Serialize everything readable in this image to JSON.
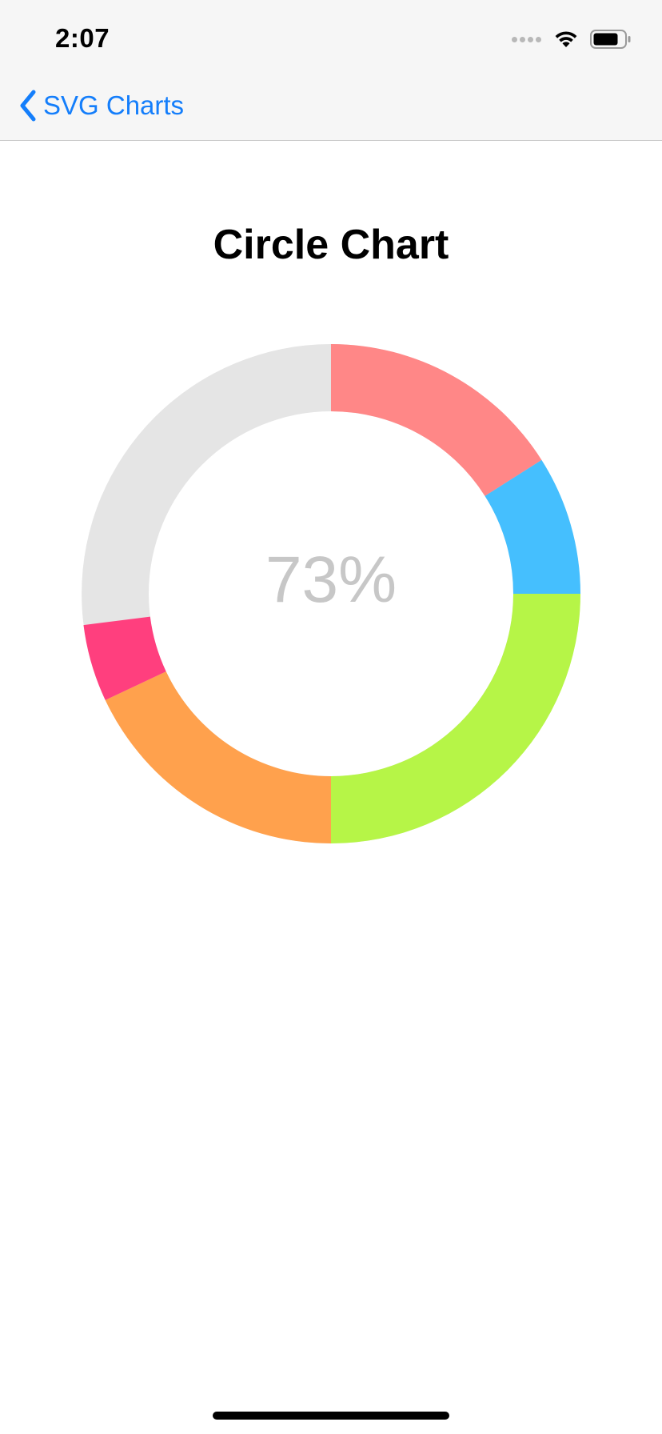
{
  "status_bar": {
    "time": "2:07"
  },
  "nav": {
    "back_label": "SVG Charts"
  },
  "page": {
    "title": "Circle Chart"
  },
  "colors": {
    "accent": "#147efb",
    "track": "#e5e5e5",
    "center_text": "#c7c7c7"
  },
  "chart_data": {
    "type": "pie",
    "variant": "donut",
    "center_label": "73%",
    "start_angle": "top, clockwise",
    "total": 100,
    "slices": [
      {
        "value": 16,
        "color": "#ff8787"
      },
      {
        "value": 9,
        "color": "#45bffe"
      },
      {
        "value": 25,
        "color": "#b6f547"
      },
      {
        "value": 18,
        "color": "#ffa14d"
      },
      {
        "value": 5,
        "color": "#ff3f7e"
      }
    ],
    "remainder_color": "#e5e5e5"
  }
}
